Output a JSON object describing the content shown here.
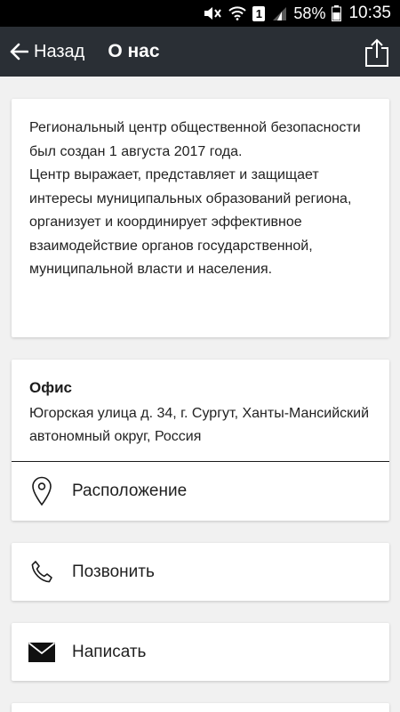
{
  "status_bar": {
    "battery": "58%",
    "time": "10:35",
    "sim": "1",
    "icons": [
      "mute-icon",
      "wifi-icon",
      "sim-icon",
      "signal-icon",
      "battery-icon"
    ]
  },
  "app_bar": {
    "back_label": "Назад",
    "title": "О нас",
    "icons": [
      "back-arrow-icon",
      "share-icon"
    ],
    "background": "#2a2f35"
  },
  "about": {
    "paragraphs": [
      "Региональный центр общественной безопасности был создан 1 августа 2017 года.",
      "Центр выражает, представляет и защищает интересы муниципальных образований региона, организует и координирует эффективное взаимодействие органов государственной, муниципальной власти и населения."
    ]
  },
  "office": {
    "title": "Офис",
    "address": "Югорская улица д. 34, г. Сургут, Ханты-Мансийский автономный округ, Россия",
    "location_label": "Расположение"
  },
  "actions": {
    "call_label": "Позвонить",
    "write_label": "Написать"
  }
}
